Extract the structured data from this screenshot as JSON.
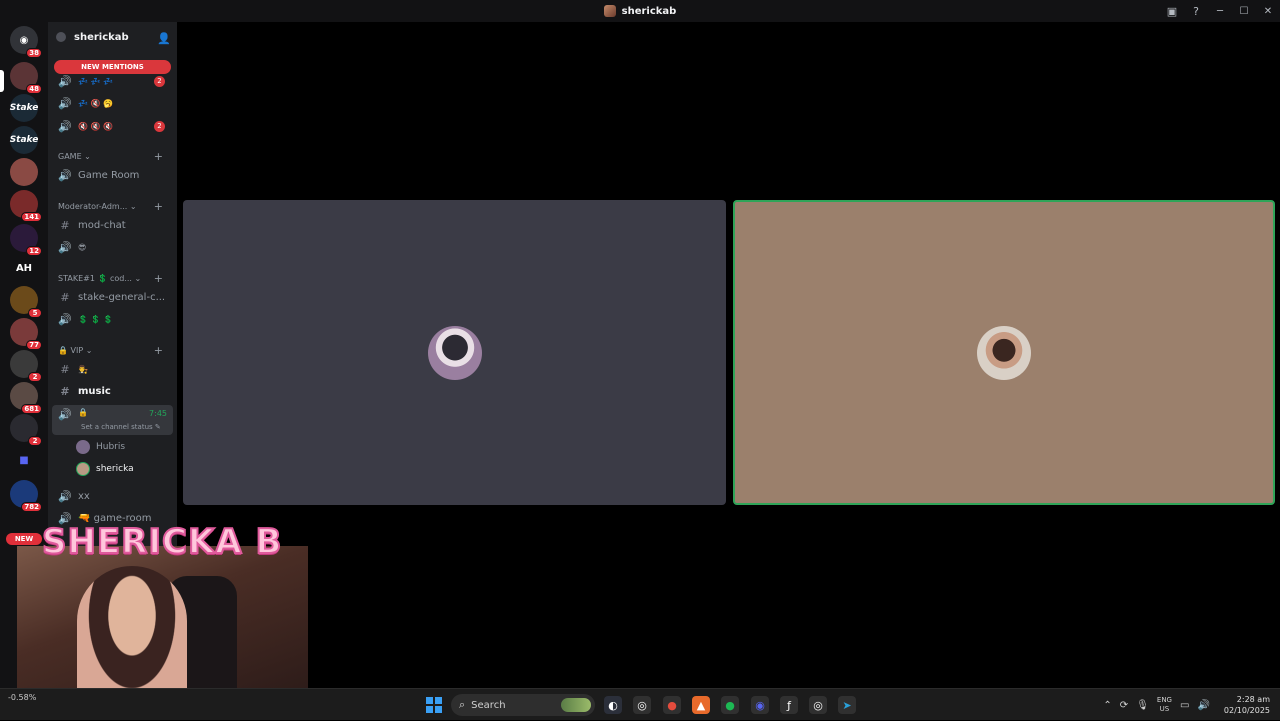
{
  "window": {
    "title": "sherickab"
  },
  "server_rail": {
    "home_badge": "38",
    "servers": [
      {
        "badge": "48"
      },
      {
        "label": "Stake"
      },
      {
        "label": "Stake"
      },
      {
        "badge": ""
      },
      {
        "badge": "141"
      },
      {
        "badge": "12"
      },
      {
        "label": "AH"
      },
      {
        "badge": "5"
      },
      {
        "badge": "77"
      },
      {
        "badge": "2"
      },
      {
        "badge": "681"
      },
      {
        "badge": "2"
      },
      {
        "badge": ""
      },
      {
        "badge": "782"
      }
    ],
    "new_label": "NEW"
  },
  "sidebar": {
    "server_name": "sherickab",
    "new_mentions": "NEW MENTIONS",
    "top_voice": [
      {
        "emojis": "💤 💤 💤",
        "count": "2"
      },
      {
        "emojis": "💤 🔇 🥱",
        "count": ""
      },
      {
        "emojis": "🔇 🔇 🔇",
        "count": "2"
      }
    ],
    "categories": {
      "game": "GAME",
      "moderator": "Moderator-Adm...",
      "stake": "STAKE#1 💲 cod...",
      "vip": "VIP"
    },
    "channels": {
      "game_room": "Game Room",
      "mod_chat": "mod-chat",
      "mod_voice_emoji": "😎",
      "stake_general": "stake-general-c...",
      "stake_voice": "💲 💲 💲",
      "vip_text_emoji": "👨‍⚖️",
      "music": "music",
      "active_voice_name": "🔒",
      "active_timer": "7:45",
      "set_status": "Set a channel status ✎",
      "xx": "xx",
      "game_room2": "🔫 game-room"
    },
    "members": [
      {
        "name": "Hubris"
      },
      {
        "name": "shericka"
      }
    ]
  },
  "call": {
    "tiles": [
      {
        "name": "hubris-tile"
      },
      {
        "name": "shericka-tile",
        "speaking": true
      }
    ]
  },
  "webcam": {
    "overlay_title": "SHERICKA B"
  },
  "taskbar": {
    "weather": "-0.58%",
    "search_placeholder": "Search",
    "lang_top": "ENG",
    "lang_bottom": "US",
    "time": "2:28 am",
    "date": "02/10/2025"
  },
  "colors": {
    "speaking_border": "#2fa458",
    "mention_red": "#da373c",
    "tile_dark": "#3b3b46",
    "tile_tan": "#9b806c"
  }
}
